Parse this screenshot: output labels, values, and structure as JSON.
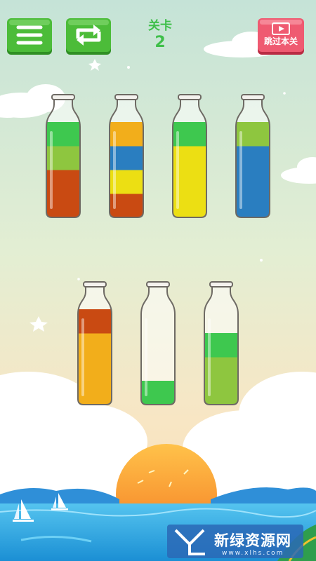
{
  "hud": {
    "level_label": "关卡",
    "level_number": "2",
    "skip_label": "跳过本关"
  },
  "icons": {
    "menu": "menu-icon",
    "restart": "restart-icon",
    "skip_video": "video-icon"
  },
  "colors": {
    "green_button": "#3fae2f",
    "skip_button": "#e84a62",
    "level_text": "#3fbf4a",
    "red": "#c94a12",
    "green": "#3ec84f",
    "lime": "#8ec63f",
    "yellow_orange": "#f2ae1b",
    "yellow": "#ecdf13",
    "blue": "#2a7ec0"
  },
  "bottles": [
    {
      "layers": [
        "red",
        "red",
        "lime",
        "green"
      ]
    },
    {
      "layers": [
        "red",
        "yellow",
        "blue",
        "yellow_orange"
      ]
    },
    {
      "layers": [
        "yellow",
        "yellow",
        "yellow",
        "green"
      ]
    },
    {
      "layers": [
        "blue",
        "blue",
        "blue",
        "lime"
      ]
    },
    {
      "layers": [
        "yellow_orange",
        "yellow_orange",
        "yellow_orange",
        "red"
      ]
    },
    {
      "layers": [
        "green"
      ]
    },
    {
      "layers": [
        "lime",
        "lime",
        "green"
      ]
    }
  ],
  "watermark": {
    "text": "新绿资源网",
    "url": "www.xlhs.com"
  }
}
